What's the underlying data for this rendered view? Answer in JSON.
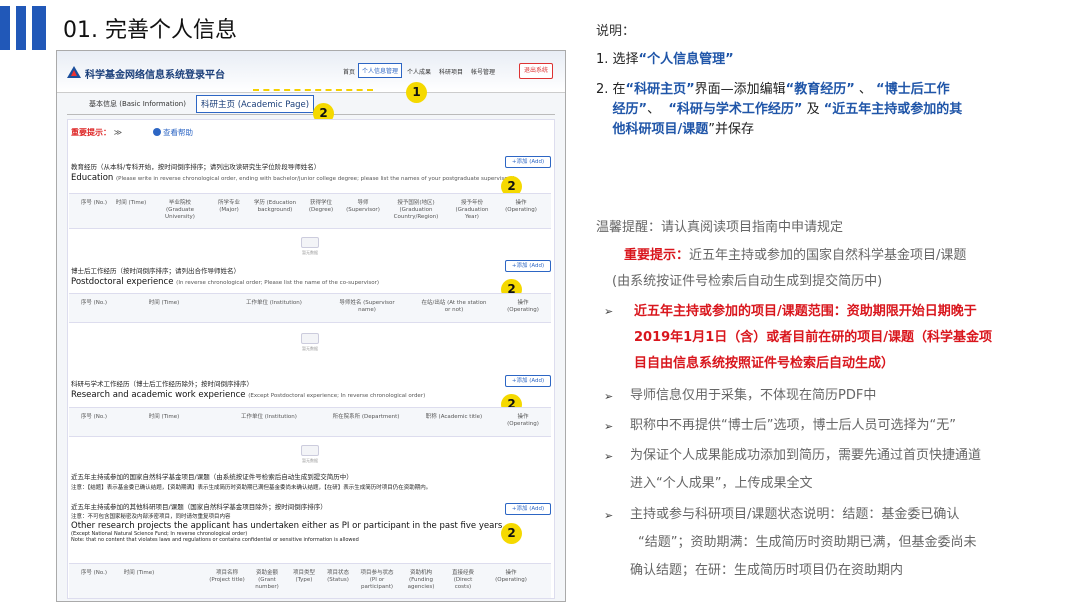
{
  "slide": {
    "title": "01. 完善个人信息"
  },
  "screenshot": {
    "brand": "科学基金网络信息系统登录平台",
    "nav": [
      "首页",
      "个人信息管理",
      "个人成果",
      "科研项目",
      "帐号管理"
    ],
    "exit_label": "退出系统",
    "tabs": {
      "basic": "基本信息 (Basic Information)",
      "academic": "科研主页 (Academic Page)"
    },
    "notice_label": "重要提示：",
    "notice_chevron": "≫",
    "help_label": "查看帮助",
    "add_label": "+添加 (Add)",
    "no_data": "暂无数据",
    "sections": [
      {
        "zh": "教育经历（从本科/专科开始，按时间倒序排序；请列出攻读研究生学位阶段导师姓名）",
        "en": "Education",
        "en_note": "(Please write in reverse chronological order, ending with bachelor/junior college degree; please list the names of your postgraduate supervisors)",
        "cols": [
          "序号 (No.)",
          "时间 (Time)",
          "毕业院校 (Graduate University)",
          "所学专业 (Major)",
          "学历 (Education background)",
          "获得学位 (Degree)",
          "导师 (Supervisor)",
          "授予国别(地区) (Graduation Country/Region)",
          "授予年份 (Graduation Year)",
          "操作 (Operating)"
        ]
      },
      {
        "zh": "博士后工作经历（按时间倒序排序；请列出合作导师姓名）",
        "en": "Postdoctoral experience",
        "en_note": "(In reverse chronological order; Please list the name of the co-supervisor)",
        "cols": [
          "序号 (No.)",
          "时间 (Time)",
          "工作单位 (Institution)",
          "导师姓名 (Supervisor name)",
          "在站/出站 (At the station or not)",
          "操作 (Operating)"
        ]
      },
      {
        "zh": "科研与学术工作经历（博士后工作经历除外；按时间倒序排序）",
        "en": "Research and academic work experience",
        "en_note": "(Except Postdoctoral experience; In reverse chronological order)",
        "cols": [
          "序号 (No.)",
          "时间 (Time)",
          "工作单位 (Institution)",
          "所在院系所 (Department)",
          "职称 (Academic title)",
          "操作 (Operating)"
        ]
      },
      {
        "zh": "近五年主持或参加的国家自然科学基金项目/课题（由系统按证件号检索后自动生成到提交简历中）",
        "en_note": "注意：【结题】表示基金委已确认结题，【资助期满】表示生成简历时资助期已满但基金委尚未确认结题，【在研】表示生成简历时项目仍在资助期内。"
      },
      {
        "zh": "近五年主持或参加的其他科研项目/课题（国家自然科学基金项目除外；按时间倒序排序）",
        "zh2": "注意：不可包含国家秘密及内部涉密项目，同时请勿重复项目内容",
        "en": "Other research projects the applicant has undertaken either as PI or participant in the past five years.",
        "en_note": "(Except National Natural Science Fund; In reverse chronological order)",
        "note2": "Note: that no content that violates laws and regulations or contains confidential or sensitive information is allowed",
        "cols": [
          "序号 (No.)",
          "时间 (Time)",
          "项目名称 (Project title)",
          "资助金额 (Grant number)",
          "项目类型 (Type)",
          "项目状态 (Status)",
          "项目参与状态 (PI or participant)",
          "资助机构 (Funding agencies)",
          "直接经费 (Direct costs)",
          "操作 (Operating)"
        ]
      }
    ],
    "badges": [
      "1",
      "2",
      "2",
      "2",
      "2",
      "2"
    ]
  },
  "panel": {
    "heading": "说明：",
    "step1_pre": "1.  选择",
    "step1_em": "“个人信息管理”",
    "step2_pre": "2.  在",
    "step2_a": "“科研主页”",
    "step2_mid": "界面—添加编辑",
    "step2_b": "“教育经历”",
    "step2_sep": "、",
    "step2_c": "“博士后工作",
    "step2_c2": "经历”",
    "step2_sep2": "、",
    "step2_d": "“科研与学术工作经历”",
    "step2_and": "及",
    "step2_e": "“近五年主持或参加的其",
    "step2_e2": "他科研项目/课题",
    "step2_end": "”并保存",
    "tip": "温馨提醒：请认真阅读项目指南中申请规定",
    "imp_label": "重要提示：",
    "imp_text": "近五年主持或参加的国家自然科学基金项目/课题",
    "imp_text2": "(由系统按证件号检索后自动生成到提交简历中)",
    "bullet1_l1": "近五年主持或参加的项目/课题范围：资助期限开始日期晚于",
    "bullet1_l2": "2019年1月1日（含）或者目前在研的项目/课题（科学基金项",
    "bullet1_l3": "目自由信息系统按照证件号检索后自动生成）",
    "bullet2": "导师信息仅用于采集，不体现在简历PDF中",
    "bullet3": "职称中不再提供“博士后”选项，博士后人员可选择为“无”",
    "bullet4_l1": "为保证个人成果能成功添加到简历，需要先通过首页快捷通道",
    "bullet4_l2": "进入“个人成果”，上传成果全文",
    "bullet5_l1": "主持或参与科研项目/课题状态说明：结题：基金委已确认",
    "bullet5_l2": "“结题”；资助期满：生成简历时资助期已满，但基金委尚未",
    "bullet5_l3": "确认结题；在研：生成简历时项目仍在资助期内",
    "arrow": "➢"
  }
}
